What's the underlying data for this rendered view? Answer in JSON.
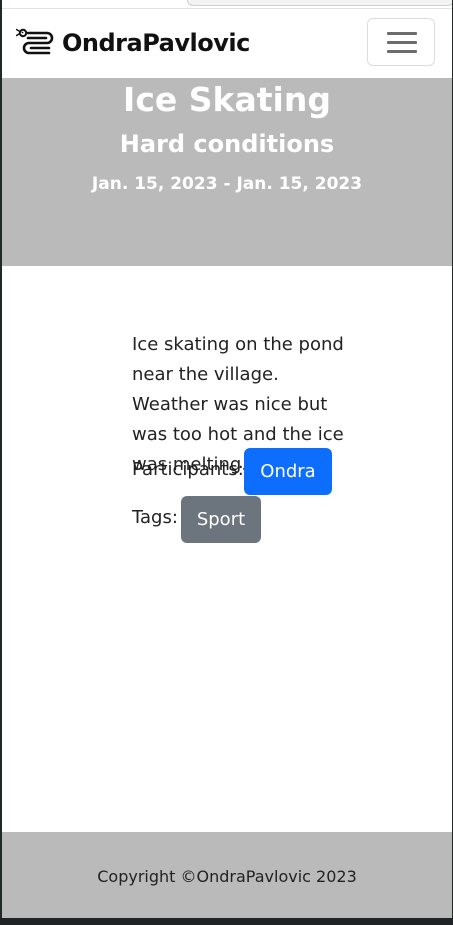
{
  "navbar": {
    "brand": "OndraPavlovic",
    "logo_icon": "snake-logo-icon",
    "menu_icon": "hamburger-menu-icon"
  },
  "hero": {
    "title": "Ice Skating",
    "subtitle": "Hard conditions",
    "date_range": "Jan. 15, 2023 - Jan. 15, 2023"
  },
  "content": {
    "description": "Ice skating on the pond near the village. Weather was nice but was too hot and the ice was melting.",
    "participants_label": "Participants:",
    "participants": [
      "Ondra"
    ],
    "tags_label": "Tags:",
    "tags": [
      "Sport"
    ]
  },
  "footer": {
    "copyright": "Copyright ©OndraPavlovic 2023"
  },
  "colors": {
    "hero_bg": "#bababa",
    "participant_badge": "#0d6efd",
    "tag_badge": "#6c757d"
  }
}
